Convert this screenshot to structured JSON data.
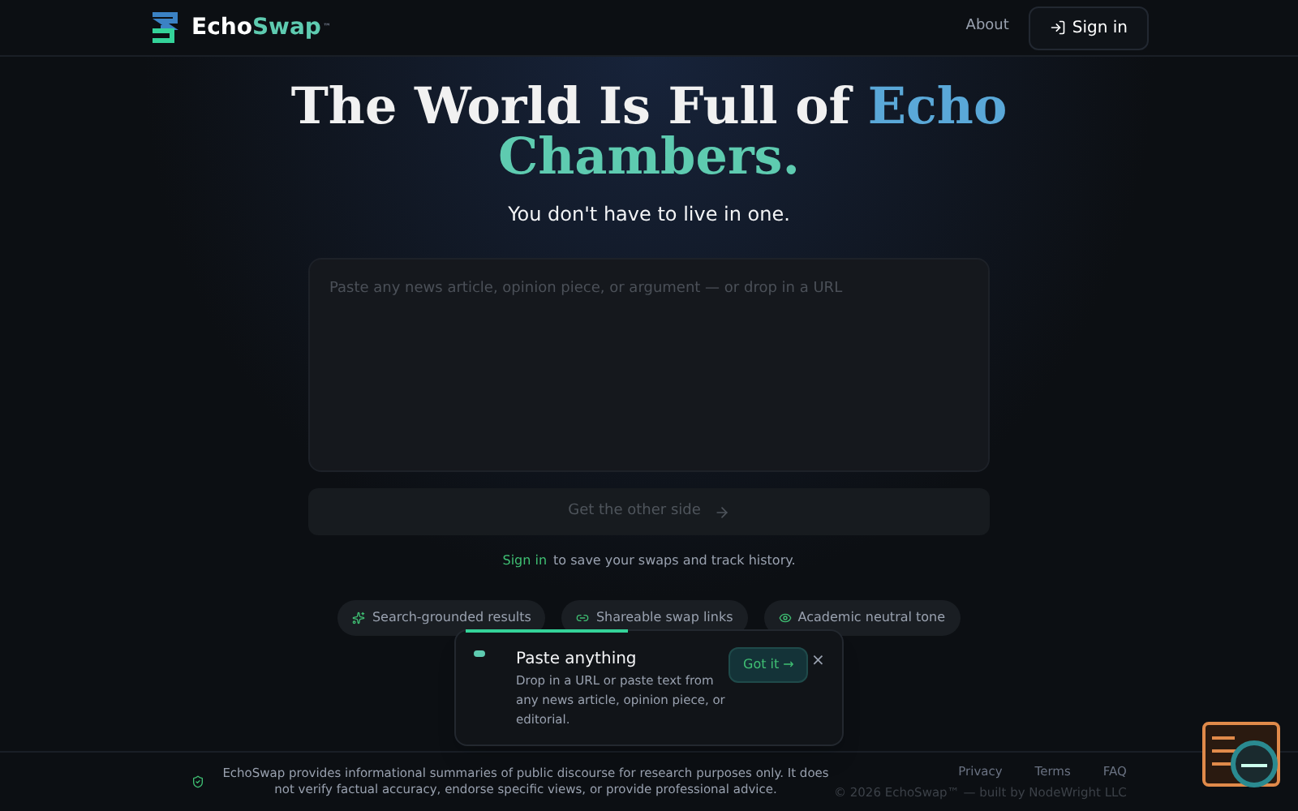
{
  "header": {
    "logo_first": "Echo",
    "logo_second": "Swap",
    "logo_mark": "™",
    "nav_link": "About",
    "sign_in": "Sign in"
  },
  "hero": {
    "title_plain": "The World Is Full of",
    "title_accent_1": "Echo",
    "title_accent_2": "Chambers.",
    "subtitle": "You don't have to live in one."
  },
  "input": {
    "placeholder": "Paste any news article, opinion piece, or argument — or drop in a URL"
  },
  "submit": {
    "label": "Get the other side",
    "disabled": true
  },
  "signin_note": {
    "link": "Sign in",
    "text": "to save your swaps and track history."
  },
  "features": [
    {
      "label": "Search-grounded results"
    },
    {
      "label": "Shareable swap links"
    },
    {
      "label": "Academic neutral tone"
    }
  ],
  "tour": {
    "title": "Paste anything",
    "body": "Drop in a URL or paste text from any news article, opinion piece, or editorial.",
    "button": "Got it →",
    "close": "×"
  },
  "footer": {
    "disclaimer": "EchoSwap provides informational summaries of public discourse for research purposes only. It does not verify factual accuracy, endorse specific views, or provide professional advice.",
    "links": [
      "Privacy",
      "Terms",
      "FAQ"
    ],
    "copyright": "© 2026 EchoSwap™ — built by NodeWright LLC"
  }
}
